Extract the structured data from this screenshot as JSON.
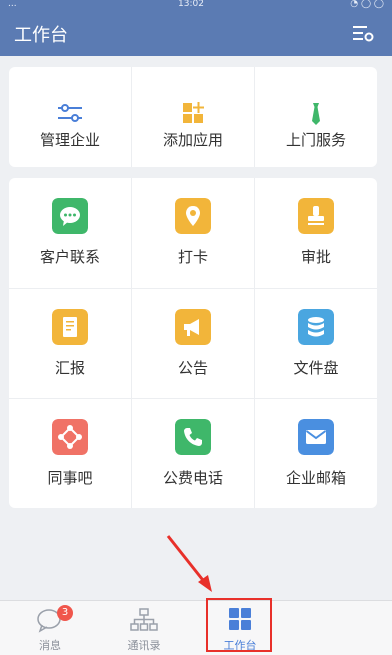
{
  "status_bar": {
    "left": "...",
    "time": "13:02",
    "right": "◔ ◯ ◯"
  },
  "header": {
    "title": "工作台",
    "settings_icon": "settings-list-icon"
  },
  "top_actions": [
    {
      "label": "管理企业",
      "icon": "sliders-icon",
      "color": "#4a7fd8"
    },
    {
      "label": "添加应用",
      "icon": "add-app-icon",
      "color": "#f2b53a"
    },
    {
      "label": "上门服务",
      "icon": "tie-icon",
      "color": "#3fb76a"
    }
  ],
  "apps": [
    {
      "label": "客户联系",
      "icon": "chat-icon",
      "color": "#3fb76a"
    },
    {
      "label": "打卡",
      "icon": "location-pin-icon",
      "color": "#f2b53a"
    },
    {
      "label": "审批",
      "icon": "stamp-icon",
      "color": "#f2b53a"
    },
    {
      "label": "汇报",
      "icon": "report-icon",
      "color": "#f2b53a"
    },
    {
      "label": "公告",
      "icon": "megaphone-icon",
      "color": "#f2b53a"
    },
    {
      "label": "文件盘",
      "icon": "database-icon",
      "color": "#4aa6e0"
    },
    {
      "label": "同事吧",
      "icon": "network-icon",
      "color": "#f07266"
    },
    {
      "label": "公费电话",
      "icon": "phone-icon",
      "color": "#3fb76a"
    },
    {
      "label": "企业邮箱",
      "icon": "mail-icon",
      "color": "#4a8fe0"
    }
  ],
  "bottom_nav": [
    {
      "label": "消息",
      "icon": "chat-bubble-icon",
      "badge": "3"
    },
    {
      "label": "通讯录",
      "icon": "org-chart-icon"
    },
    {
      "label": "工作台",
      "icon": "grid-icon",
      "active": true
    }
  ],
  "colors": {
    "header": "#5b7bb3",
    "active": "#4a7fd8",
    "highlight": "#e8302a"
  }
}
